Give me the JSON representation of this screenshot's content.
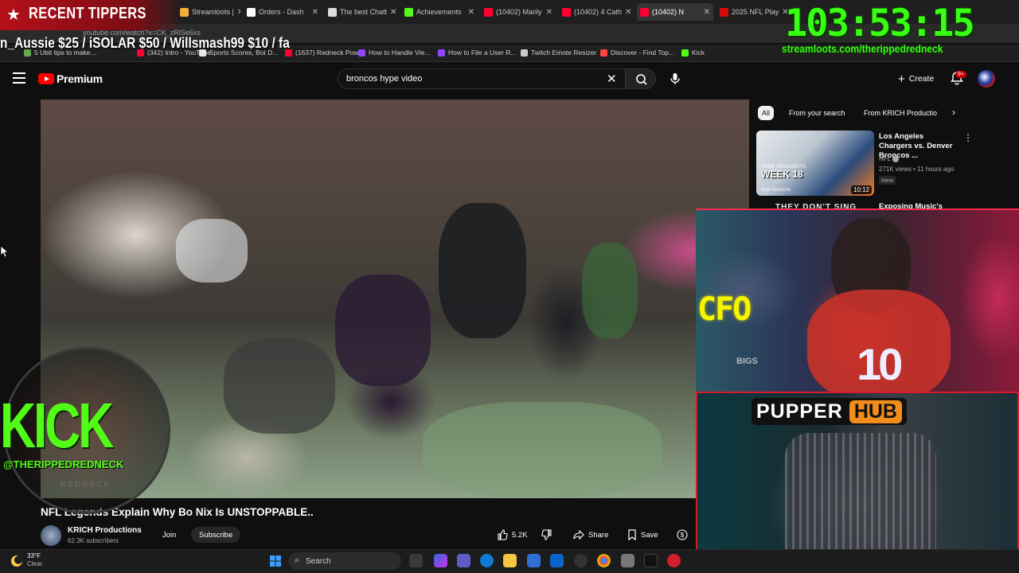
{
  "browser": {
    "tabs": [
      {
        "label": "Streamloots |",
        "color": "#f2b13a",
        "active": false
      },
      {
        "label": "Orders - Dash",
        "color": "#ffffff",
        "active": false
      },
      {
        "label": "The best Chatt",
        "color": "#dddddd",
        "active": false
      },
      {
        "label": "Achievements",
        "color": "#53fc18",
        "active": false
      },
      {
        "label": "(10402) Marily",
        "color": "#ff0033",
        "active": false
      },
      {
        "label": "(10402) 4 Cath",
        "color": "#ff0033",
        "active": false
      },
      {
        "label": "(10402) N",
        "color": "#ff0033",
        "active": true
      },
      {
        "label": "2025 NFL Play",
        "color": "#d50a0a",
        "active": false
      }
    ],
    "url": "youtube.com/watch?v=CK_zRlSe6xs",
    "bookmarks": [
      {
        "label": "5 Ubit tips to make...",
        "color": "#6aa84f"
      },
      {
        "label": "(342) Intro - YouTube",
        "color": "#ff0033"
      },
      {
        "label": "Sports Scores, Bot D...",
        "color": "#e8e8e8"
      },
      {
        "label": "(1637) Redneck Pow...",
        "color": "#ff0033"
      },
      {
        "label": "How to Handle Vie...",
        "color": "#9146ff"
      },
      {
        "label": "How to File a User R...",
        "color": "#9146ff"
      },
      {
        "label": "Twitch Emote Resizer",
        "color": "#cccccc"
      },
      {
        "label": "Discover - Find Top...",
        "color": "#ff4444"
      },
      {
        "label": "Kick",
        "color": "#53fc18"
      }
    ]
  },
  "overlay": {
    "tipper_title": "RECENT TIPPERS",
    "tipper_scroll": "n_Aussie $25 / iSOLAR $50 / Willsmash99 $10 / fa",
    "timer": "103:53:15",
    "timer_url": "streamloots.com/therippedredneck",
    "kick_text": "KICK",
    "kick_handle": "@THERIPPEDREDNECK",
    "kick_sub": "REDNECK",
    "webcam_sign": "CFO",
    "webcam_jersey": "10",
    "webcam_big": "BIGS",
    "pupper": "PUPPER",
    "hub": "HUB"
  },
  "youtube": {
    "logo": "Premium",
    "search_value": "broncos hype video",
    "create_label": "Create",
    "notification_count": "9+",
    "video": {
      "title": "NFL Legends Explain Why Bo Nix Is UNSTOPPABLE..",
      "channel": "KRICH Productions",
      "subscribers": "62.3K subscribers",
      "join_label": "Join",
      "subscribe_label": "Subscribe",
      "likes": "5.2K",
      "share_label": "Share",
      "save_label": "Save"
    },
    "chips": [
      "All",
      "From your search",
      "From KRICH Productio"
    ],
    "recommendations": [
      {
        "title": "Los Angeles Chargers vs. Denver Broncos ...",
        "channel": "NFL",
        "meta": "271K views • 11 hours ago",
        "badge": "New",
        "duration": "10:12",
        "thumb_line1": "GAME HIGHLIGHTS",
        "thumb_week": "WEEK 18",
        "thumb_season": "2025 SEASON"
      },
      {
        "title": "Exposing Music's",
        "thumb_text": "THEY DON'T SING"
      }
    ]
  },
  "taskbar": {
    "temp": "33°F",
    "condition": "Clear",
    "search_placeholder": "Search"
  }
}
